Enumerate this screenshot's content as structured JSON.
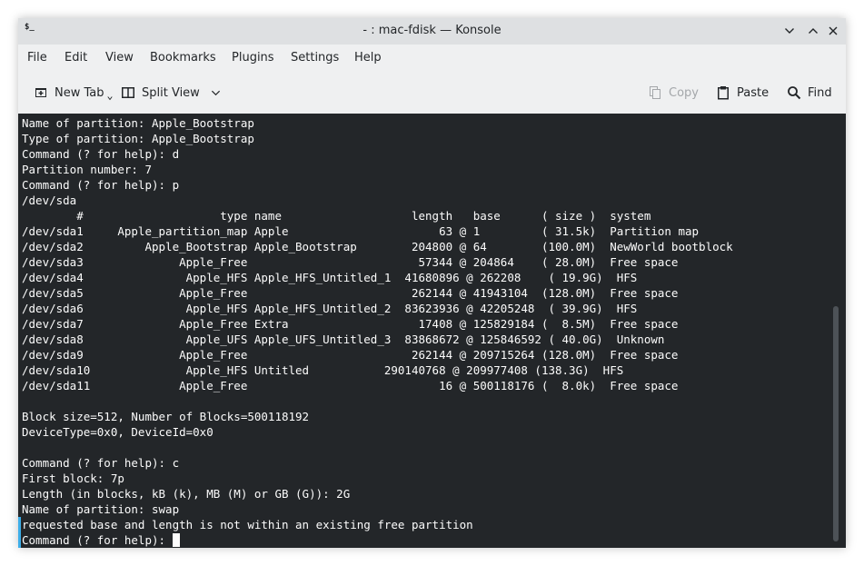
{
  "window": {
    "title": "- : mac-fdisk — Konsole",
    "app_icon": "$_"
  },
  "menu": [
    "File",
    "Edit",
    "View",
    "Bookmarks",
    "Plugins",
    "Settings",
    "Help"
  ],
  "toolbar": {
    "new_tab": "New Tab",
    "split_view": "Split View",
    "copy": "Copy",
    "paste": "Paste",
    "find": "Find"
  },
  "terminal": {
    "lines": [
      "Name of partition: Apple_Bootstrap",
      "Type of partition: Apple_Bootstrap",
      "Command (? for help): d",
      "Partition number: 7",
      "Command (? for help): p",
      "/dev/sda",
      "        #                    type name                   length   base      ( size )  system",
      "/dev/sda1     Apple_partition_map Apple                      63 @ 1         ( 31.5k)  Partition map",
      "/dev/sda2         Apple_Bootstrap Apple_Bootstrap        204800 @ 64        (100.0M)  NewWorld bootblock",
      "/dev/sda3              Apple_Free                         57344 @ 204864    ( 28.0M)  Free space",
      "/dev/sda4               Apple_HFS Apple_HFS_Untitled_1  41680896 @ 262208    ( 19.9G)  HFS",
      "/dev/sda5              Apple_Free                        262144 @ 41943104  (128.0M)  Free space",
      "/dev/sda6               Apple_HFS Apple_HFS_Untitled_2  83623936 @ 42205248  ( 39.9G)  HFS",
      "/dev/sda7              Apple_Free Extra                   17408 @ 125829184 (  8.5M)  Free space",
      "/dev/sda8               Apple_UFS Apple_UFS_Untitled_3  83868672 @ 125846592 ( 40.0G)  Unknown",
      "/dev/sda9              Apple_Free                        262144 @ 209715264 (128.0M)  Free space",
      "/dev/sda10              Apple_HFS Untitled           290140768 @ 209977408 (138.3G)  HFS",
      "/dev/sda11             Apple_Free                            16 @ 500118176 (  8.0k)  Free space",
      "",
      "Block size=512, Number of Blocks=500118192",
      "DeviceType=0x0, DeviceId=0x0",
      "",
      "Command (? for help): c",
      "First block: 7p",
      "Length (in blocks, kB (k), MB (M) or GB (G)): 2G",
      "Name of partition: swap",
      "requested base and length is not within an existing free partition",
      "Command (? for help): "
    ]
  }
}
